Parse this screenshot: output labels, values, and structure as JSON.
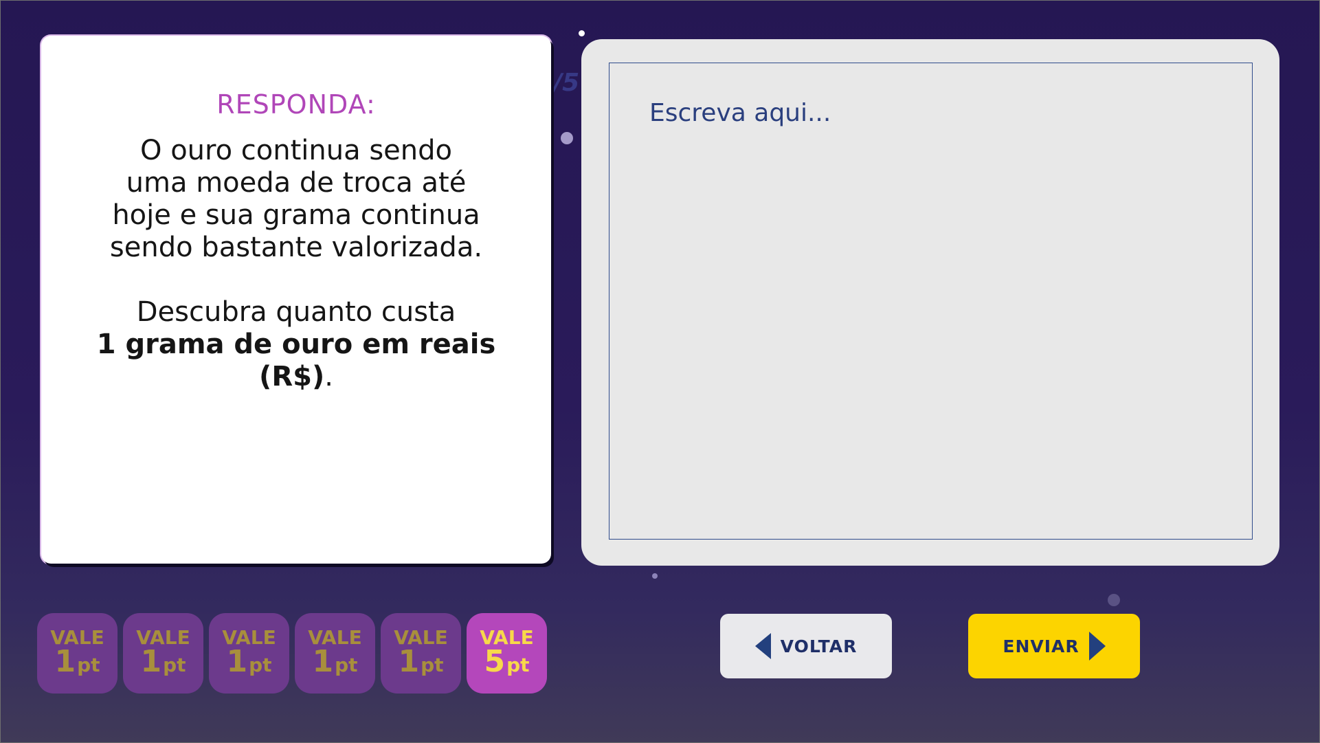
{
  "background": {
    "ghost_counter": "/5"
  },
  "question": {
    "heading": "RESPONDA:",
    "text_lines": [
      "O ouro continua sendo",
      "uma moeda de troca até",
      "hoje e sua grama continua",
      "sendo bastante valorizada."
    ],
    "instruction_line1": "Descubra quanto custa",
    "instruction_bold": "1 grama de ouro em reais (R$)",
    "instruction_end": "."
  },
  "answer": {
    "placeholder": "Escreva aqui..."
  },
  "points": [
    {
      "vale": "VALE",
      "number": "1",
      "unit": "pt",
      "active": false
    },
    {
      "vale": "VALE",
      "number": "1",
      "unit": "pt",
      "active": false
    },
    {
      "vale": "VALE",
      "number": "1",
      "unit": "pt",
      "active": false
    },
    {
      "vale": "VALE",
      "number": "1",
      "unit": "pt",
      "active": false
    },
    {
      "vale": "VALE",
      "number": "1",
      "unit": "pt",
      "active": false
    },
    {
      "vale": "VALE",
      "number": "5",
      "unit": "pt",
      "active": true
    }
  ],
  "buttons": {
    "back_label": "VOLTAR",
    "send_label": "ENVIAR"
  },
  "colors": {
    "accent_purple": "#b046b8",
    "send_yellow": "#fcd400",
    "text_navy": "#1f2f68"
  }
}
